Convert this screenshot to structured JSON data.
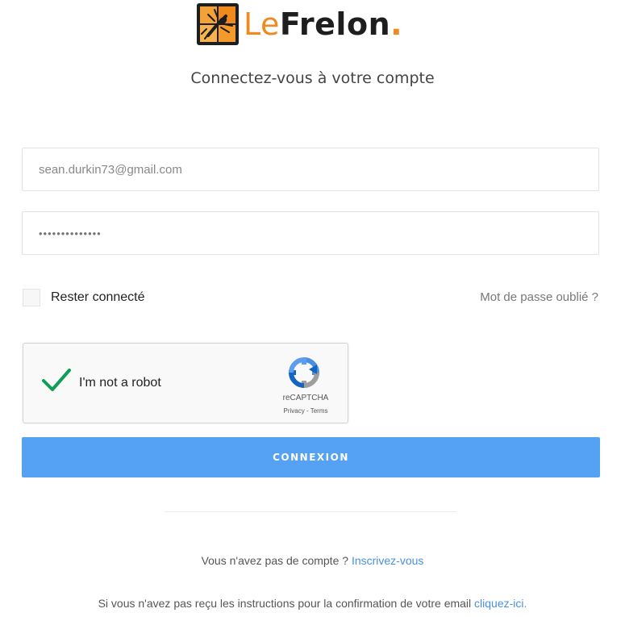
{
  "brand": {
    "name_part1": "Le",
    "name_part2": "Frelon",
    "name_dot": ".",
    "accent_color": "#f08a1c",
    "dark_color": "#1e1e1e"
  },
  "subtitle": "Connectez-vous à votre compte",
  "form": {
    "email_value": "sean.durkin73@gmail.com",
    "password_value": "••••••••••••••",
    "remember_label": "Rester connecté",
    "remember_checked": false,
    "forgot_label": "Mot de passe oublié ?",
    "submit_label": "CONNEXION",
    "submit_color": "#55a1f3"
  },
  "recaptcha": {
    "label": "I'm not a robot",
    "brand": "reCAPTCHA",
    "links": "Privacy - Terms",
    "checked": true,
    "check_color": "#0f9d58"
  },
  "footer": {
    "signup_text": "Vous n'avez pas de compte ?",
    "signup_link": "Inscrivez-vous",
    "confirm_text": "Si vous n'avez pas reçu les instructions pour la confirmation de votre email",
    "confirm_link": "cliquez-ici.",
    "link_color": "#4a8fe0"
  }
}
